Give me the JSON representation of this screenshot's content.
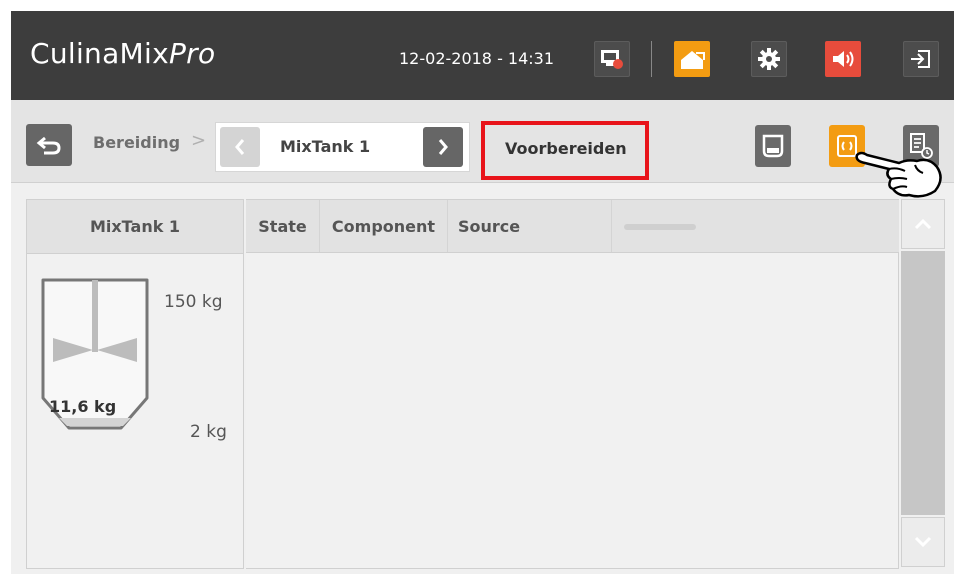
{
  "header": {
    "title_main": "CulinaMix",
    "title_italic": "Pro",
    "datetime": "12-02-2018 - 14:31",
    "icons": [
      "screen-alert-icon",
      "home-icon",
      "gear-icon",
      "speaker-icon",
      "logout-icon"
    ]
  },
  "navbar": {
    "breadcrumb": "Bereiding",
    "breadcrumb_separator": ">",
    "tank_selector": {
      "value": "MixTank 1"
    },
    "current_step": "Voorbereiden",
    "right_icons": [
      "tank-icon",
      "cycle-icon",
      "schedule-list-icon"
    ]
  },
  "tank_panel": {
    "title": "MixTank 1",
    "level_max": "150 kg",
    "level_min": "2 kg",
    "current_weight": "11,6 kg"
  },
  "table": {
    "columns": [
      "State",
      "Component",
      "Source",
      ""
    ],
    "rows": []
  },
  "colors": {
    "topbar": "#3d3d3d",
    "accent_orange": "#f39c12",
    "alert_red": "#e74c3c",
    "highlight_red": "#e8131a"
  }
}
